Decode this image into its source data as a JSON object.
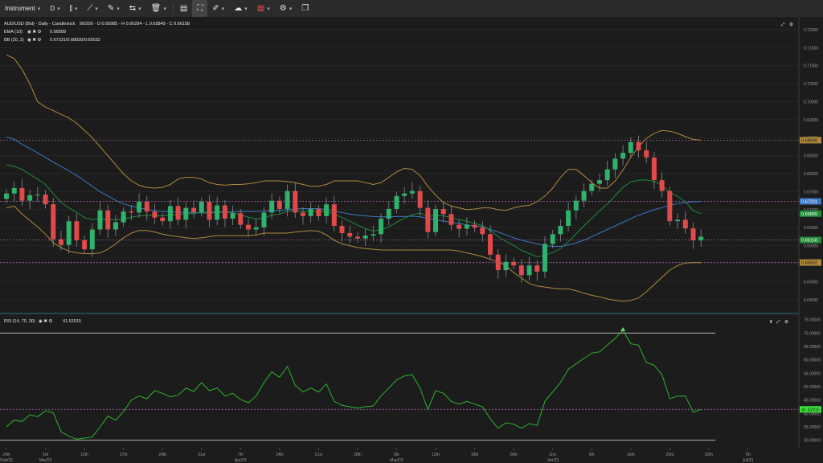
{
  "toolbar": {
    "instrument_label": "Instrument",
    "timeframe_label": "D",
    "icons": [
      "candle-type-icon",
      "drawing-tools-icon",
      "measure-icon",
      "compare-icon",
      "trash-icon",
      "panel-icon",
      "fullscreen-icon",
      "pen-icon",
      "weather-icon",
      "uk-flag-icon",
      "window-icon"
    ]
  },
  "price_panel": {
    "info_line": "AUD/USD (Bid) - Daily - Candlestick",
    "ohlc_text": "90/200 - O 0.65985 - H 0.66294 - L 0.65849 - C 0.66158",
    "ema_label": "EMA (10)",
    "ema_value": "0.66899",
    "bb_label": "BB (20, 2)",
    "bb_value": "0.67231/0.68930/0.65532",
    "expand_icon": "expand-icon",
    "settings_icon": "gear-icon"
  },
  "rsi_panel": {
    "label": "RSI (14, 70, 30)",
    "value": "41.52015",
    "current_tag": "41.52015"
  },
  "price_tags": {
    "bb_upper": "0.68930",
    "bb_middle": "0.67231",
    "ema": "0.66899",
    "close": "0.66158",
    "bb_lower": "0.65532"
  },
  "colors": {
    "up": "#2fb26b",
    "down": "#e04a4a",
    "ema": "#1f8c3a",
    "bb_mid": "#3b78c4",
    "bb_band": "#b08a3c",
    "rsi": "#2bb52b",
    "rsi_tag": "#39e639",
    "level_line": "#b266b2"
  },
  "chart_data": [
    {
      "type": "candlestick",
      "title": "AUD/USD (Bid) - Daily - Candlestick",
      "ylim": [
        0.6425,
        0.722
      ],
      "y_ticks": [
        "0.72000",
        "0.71500",
        "0.71000",
        "0.70500",
        "0.70000",
        "0.69500",
        "0.69000",
        "0.68500",
        "0.68000",
        "0.67500",
        "0.67000",
        "0.66500",
        "0.66000",
        "0.65500",
        "0.65000",
        "0.64500"
      ],
      "x_tick_labels": [
        {
          "day": "24th",
          "month": "Feb/23",
          "idx": 0
        },
        {
          "day": "3rd",
          "month": "Mar/23",
          "idx": 5
        },
        {
          "day": "10th",
          "month": "",
          "idx": 10
        },
        {
          "day": "17th",
          "month": "",
          "idx": 15
        },
        {
          "day": "24th",
          "month": "",
          "idx": 20
        },
        {
          "day": "31st",
          "month": "",
          "idx": 25
        },
        {
          "day": "7th",
          "month": "Apr/23",
          "idx": 30
        },
        {
          "day": "14th",
          "month": "",
          "idx": 35
        },
        {
          "day": "21st",
          "month": "",
          "idx": 40
        },
        {
          "day": "28th",
          "month": "",
          "idx": 45
        },
        {
          "day": "5th",
          "month": "May/23",
          "idx": 50
        },
        {
          "day": "12th",
          "month": "",
          "idx": 55
        },
        {
          "day": "19th",
          "month": "",
          "idx": 60
        },
        {
          "day": "26th",
          "month": "",
          "idx": 65
        },
        {
          "day": "2nd",
          "month": "Jun/23",
          "idx": 70
        },
        {
          "day": "9th",
          "month": "",
          "idx": 75
        },
        {
          "day": "16th",
          "month": "",
          "idx": 80
        },
        {
          "day": "23rd",
          "month": "",
          "idx": 85
        },
        {
          "day": "30th",
          "month": "",
          "idx": 90
        },
        {
          "day": "7th",
          "month": "Jul/23",
          "idx": 95
        }
      ],
      "closes": [
        0.6745,
        0.676,
        0.6725,
        0.674,
        0.6742,
        0.6715,
        0.6618,
        0.6602,
        0.6668,
        0.6615,
        0.659,
        0.6645,
        0.6698,
        0.6645,
        0.6665,
        0.6695,
        0.6692,
        0.6722,
        0.6695,
        0.6678,
        0.6668,
        0.671,
        0.6672,
        0.6705,
        0.6693,
        0.6722,
        0.6672,
        0.6712,
        0.6675,
        0.669,
        0.6658,
        0.6645,
        0.6651,
        0.6692,
        0.6725,
        0.6702,
        0.6752,
        0.6692,
        0.6682,
        0.6702,
        0.6682,
        0.6715,
        0.6655,
        0.6635,
        0.6625,
        0.662,
        0.6628,
        0.6632,
        0.6675,
        0.6702,
        0.6738,
        0.6745,
        0.6752,
        0.6705,
        0.6638,
        0.6702,
        0.6688,
        0.6658,
        0.6647,
        0.6658,
        0.665,
        0.6632,
        0.6575,
        0.6532,
        0.6555,
        0.6545,
        0.6518,
        0.6545,
        0.6528,
        0.6605,
        0.6632,
        0.6655,
        0.6698,
        0.6725,
        0.6752,
        0.6772,
        0.6782,
        0.6812,
        0.6842,
        0.6858,
        0.6888,
        0.6865,
        0.6845,
        0.6782,
        0.6752,
        0.6668,
        0.6672,
        0.6648,
        0.6615,
        0.6625
      ],
      "ema_10": [
        0.6825,
        0.682,
        0.6812,
        0.6798,
        0.6785,
        0.677,
        0.6745,
        0.672,
        0.6705,
        0.6692,
        0.6678,
        0.6672,
        0.6675,
        0.6672,
        0.6672,
        0.6674,
        0.6679,
        0.6683,
        0.6684,
        0.6684,
        0.6683,
        0.6686,
        0.6686,
        0.6688,
        0.6689,
        0.6693,
        0.6692,
        0.6694,
        0.6693,
        0.6691,
        0.6686,
        0.6679,
        0.6674,
        0.6677,
        0.6685,
        0.6688,
        0.6696,
        0.6697,
        0.6695,
        0.6696,
        0.6694,
        0.6694,
        0.6688,
        0.6678,
        0.6668,
        0.6657,
        0.6647,
        0.6641,
        0.6645,
        0.6652,
        0.6665,
        0.6676,
        0.6686,
        0.6691,
        0.6681,
        0.6684,
        0.6683,
        0.6678,
        0.6672,
        0.6668,
        0.6662,
        0.6656,
        0.6642,
        0.6625,
        0.6612,
        0.6601,
        0.6587,
        0.6578,
        0.6569,
        0.6573,
        0.6581,
        0.6592,
        0.6611,
        0.6633,
        0.6655,
        0.6676,
        0.6697,
        0.6716,
        0.6739,
        0.6762,
        0.6777,
        0.6782,
        0.6783,
        0.6778,
        0.6768,
        0.6748,
        0.6737,
        0.6722,
        0.6697,
        0.6689
      ],
      "bb_mid": [
        0.6902,
        0.6895,
        0.6882,
        0.687,
        0.6858,
        0.6845,
        0.6832,
        0.682,
        0.6808,
        0.6795,
        0.678,
        0.6765,
        0.675,
        0.6738,
        0.6726,
        0.6716,
        0.671,
        0.6705,
        0.6701,
        0.6697,
        0.6695,
        0.6694,
        0.6693,
        0.6692,
        0.6692,
        0.6691,
        0.6691,
        0.6692,
        0.6693,
        0.6694,
        0.6695,
        0.6695,
        0.6695,
        0.6696,
        0.6697,
        0.6698,
        0.67,
        0.6702,
        0.6703,
        0.6703,
        0.6703,
        0.67,
        0.6696,
        0.6692,
        0.6688,
        0.6685,
        0.6683,
        0.6681,
        0.668,
        0.668,
        0.6681,
        0.6681,
        0.6682,
        0.668,
        0.6676,
        0.6672,
        0.6668,
        0.6665,
        0.6662,
        0.6658,
        0.6655,
        0.6652,
        0.6645,
        0.6638,
        0.663,
        0.6622,
        0.6615,
        0.661,
        0.6605,
        0.66,
        0.6598,
        0.6598,
        0.6602,
        0.6608,
        0.6615,
        0.6625,
        0.6635,
        0.6645,
        0.6655,
        0.6665,
        0.6675,
        0.6685,
        0.6692,
        0.67,
        0.6706,
        0.6712,
        0.6717,
        0.672,
        0.6722,
        0.6723
      ],
      "bb_upper": [
        0.713,
        0.712,
        0.709,
        0.705,
        0.7,
        0.6985,
        0.6975,
        0.6965,
        0.6955,
        0.694,
        0.692,
        0.69,
        0.6875,
        0.685,
        0.6825,
        0.68,
        0.678,
        0.6768,
        0.6762,
        0.676,
        0.6762,
        0.677,
        0.6785,
        0.679,
        0.679,
        0.6785,
        0.6775,
        0.677,
        0.6768,
        0.677,
        0.677,
        0.6772,
        0.6775,
        0.678,
        0.678,
        0.678,
        0.6778,
        0.6775,
        0.677,
        0.6765,
        0.6765,
        0.677,
        0.678,
        0.678,
        0.678,
        0.678,
        0.6775,
        0.677,
        0.6775,
        0.679,
        0.6805,
        0.6815,
        0.6812,
        0.6795,
        0.6765,
        0.674,
        0.672,
        0.671,
        0.6705,
        0.67,
        0.6702,
        0.6705,
        0.6705,
        0.67,
        0.6698,
        0.6705,
        0.671,
        0.6712,
        0.6722,
        0.6738,
        0.676,
        0.679,
        0.6812,
        0.6812,
        0.6795,
        0.6775,
        0.676,
        0.676,
        0.678,
        0.681,
        0.6845,
        0.6875,
        0.6898,
        0.6912,
        0.692,
        0.6918,
        0.6912,
        0.6903,
        0.6895,
        0.6893
      ],
      "bb_lower": [
        0.6705,
        0.671,
        0.6688,
        0.667,
        0.6652,
        0.6632,
        0.6608,
        0.6595,
        0.6585,
        0.658,
        0.6578,
        0.6578,
        0.658,
        0.659,
        0.6605,
        0.6622,
        0.6635,
        0.6642,
        0.6642,
        0.6638,
        0.6632,
        0.6628,
        0.6625,
        0.6622,
        0.662,
        0.6622,
        0.6625,
        0.6628,
        0.6628,
        0.6628,
        0.6628,
        0.6628,
        0.663,
        0.6635,
        0.6635,
        0.6635,
        0.6635,
        0.6638,
        0.664,
        0.6642,
        0.664,
        0.663,
        0.6615,
        0.6605,
        0.66,
        0.6595,
        0.6592,
        0.659,
        0.6588,
        0.6588,
        0.6588,
        0.6588,
        0.6588,
        0.6588,
        0.6588,
        0.6588,
        0.6588,
        0.6588,
        0.6585,
        0.658,
        0.6575,
        0.657,
        0.6562,
        0.6555,
        0.6545,
        0.6525,
        0.651,
        0.6495,
        0.6488,
        0.6485,
        0.6482,
        0.648,
        0.648,
        0.6475,
        0.6468,
        0.6462,
        0.6458,
        0.6452,
        0.6448,
        0.6446,
        0.6448,
        0.6455,
        0.6472,
        0.6492,
        0.6512,
        0.6532,
        0.6545,
        0.6552,
        0.6553,
        0.6553
      ],
      "price_levels": [
        0.6893,
        0.67231,
        0.66158,
        0.65532
      ]
    },
    {
      "type": "line",
      "title": "RSI (14, 70, 30)",
      "ylim": [
        27.5,
        75.5
      ],
      "y_ticks": [
        "75.00000",
        "70.00000",
        "65.00000",
        "60.00000",
        "55.00000",
        "50.00000",
        "45.00000",
        "40.00000",
        "35.00000",
        "30.00000"
      ],
      "levels": [
        70,
        30
      ],
      "series": [
        {
          "values": [
            35,
            37.5,
            37,
            39.5,
            38.8,
            41,
            40.2,
            33.2,
            31.5,
            30.4,
            30.8,
            31.2,
            35,
            39,
            37.5,
            40.7,
            45,
            46.5,
            45.5,
            48.5,
            47.5,
            46.2,
            46.8,
            49.5,
            48.2,
            51.5,
            48.5,
            49.5,
            46.5,
            47.5,
            45.2,
            44,
            46.5,
            51.5,
            55.5,
            53.5,
            57.5,
            50.5,
            48,
            49.5,
            48,
            51,
            44.5,
            43,
            42.5,
            42,
            42.5,
            42.8,
            46.5,
            49.5,
            52.5,
            54,
            54.5,
            49.5,
            41.5,
            48.5,
            47.5,
            44.5,
            43.5,
            44.5,
            43.5,
            42.5,
            38,
            34.5,
            36.5,
            36,
            34.5,
            36.2,
            35.5,
            44.5,
            48,
            51.5,
            56.5,
            58.5,
            60.5,
            62.5,
            63,
            65.5,
            68,
            71,
            66,
            65.5,
            59,
            58,
            54.5,
            45.5,
            46.5,
            46.5,
            40.5,
            41.5
          ]
        }
      ],
      "current": 41.52015
    }
  ]
}
